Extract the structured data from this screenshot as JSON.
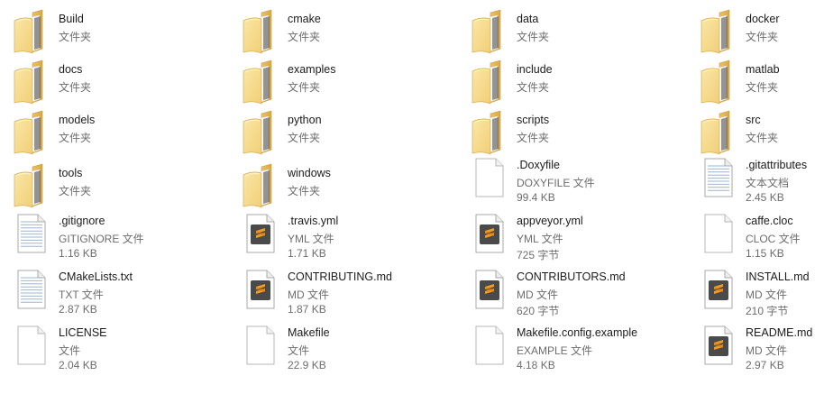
{
  "items": [
    {
      "name": "Build",
      "type": "文件夹",
      "kind": "folder",
      "icon": "folder-icon"
    },
    {
      "name": "cmake",
      "type": "文件夹",
      "kind": "folder",
      "icon": "folder-icon"
    },
    {
      "name": "data",
      "type": "文件夹",
      "kind": "folder",
      "icon": "folder-icon"
    },
    {
      "name": "docker",
      "type": "文件夹",
      "kind": "folder",
      "icon": "folder-icon"
    },
    {
      "name": "docs",
      "type": "文件夹",
      "kind": "folder",
      "icon": "folder-icon"
    },
    {
      "name": "examples",
      "type": "文件夹",
      "kind": "folder",
      "icon": "folder-icon"
    },
    {
      "name": "include",
      "type": "文件夹",
      "kind": "folder",
      "icon": "folder-icon"
    },
    {
      "name": "matlab",
      "type": "文件夹",
      "kind": "folder",
      "icon": "folder-icon"
    },
    {
      "name": "models",
      "type": "文件夹",
      "kind": "folder",
      "icon": "folder-icon"
    },
    {
      "name": "python",
      "type": "文件夹",
      "kind": "folder",
      "icon": "folder-icon"
    },
    {
      "name": "scripts",
      "type": "文件夹",
      "kind": "folder",
      "icon": "folder-icon"
    },
    {
      "name": "src",
      "type": "文件夹",
      "kind": "folder",
      "icon": "folder-icon"
    },
    {
      "name": "tools",
      "type": "文件夹",
      "kind": "folder",
      "icon": "folder-icon"
    },
    {
      "name": "windows",
      "type": "文件夹",
      "kind": "folder",
      "icon": "folder-icon"
    },
    {
      "name": ".Doxyfile",
      "type": "DOXYFILE 文件",
      "size": "99.4 KB",
      "kind": "blank",
      "icon": "blank-file-icon"
    },
    {
      "name": ".gitattributes",
      "type": "文本文档",
      "size": "2.45 KB",
      "kind": "text",
      "icon": "text-file-icon"
    },
    {
      "name": ".gitignore",
      "type": "GITIGNORE 文件",
      "size": "1.16 KB",
      "kind": "text",
      "icon": "text-file-icon"
    },
    {
      "name": ".travis.yml",
      "type": "YML 文件",
      "size": "1.71 KB",
      "kind": "sublime",
      "icon": "sublime-file-icon"
    },
    {
      "name": "appveyor.yml",
      "type": "YML 文件",
      "size": "725 字节",
      "kind": "sublime",
      "icon": "sublime-file-icon"
    },
    {
      "name": "caffe.cloc",
      "type": "CLOC 文件",
      "size": "1.15 KB",
      "kind": "blank",
      "icon": "blank-file-icon"
    },
    {
      "name": "CMakeLists.txt",
      "type": "TXT 文件",
      "size": "2.87 KB",
      "kind": "text",
      "icon": "text-file-icon"
    },
    {
      "name": "CONTRIBUTING.md",
      "type": "MD 文件",
      "size": "1.87 KB",
      "kind": "sublime",
      "icon": "sublime-file-icon"
    },
    {
      "name": "CONTRIBUTORS.md",
      "type": "MD 文件",
      "size": "620 字节",
      "kind": "sublime",
      "icon": "sublime-file-icon"
    },
    {
      "name": "INSTALL.md",
      "type": "MD 文件",
      "size": "210 字节",
      "kind": "sublime",
      "icon": "sublime-file-icon"
    },
    {
      "name": "LICENSE",
      "type": "文件",
      "size": "2.04 KB",
      "kind": "blank",
      "icon": "blank-file-icon"
    },
    {
      "name": "Makefile",
      "type": "文件",
      "size": "22.9 KB",
      "kind": "blank",
      "icon": "blank-file-icon"
    },
    {
      "name": "Makefile.config.example",
      "type": "EXAMPLE 文件",
      "size": "4.18 KB",
      "kind": "blank",
      "icon": "blank-file-icon"
    },
    {
      "name": "README.md",
      "type": "MD 文件",
      "size": "2.97 KB",
      "kind": "sublime",
      "icon": "sublime-file-icon"
    }
  ]
}
